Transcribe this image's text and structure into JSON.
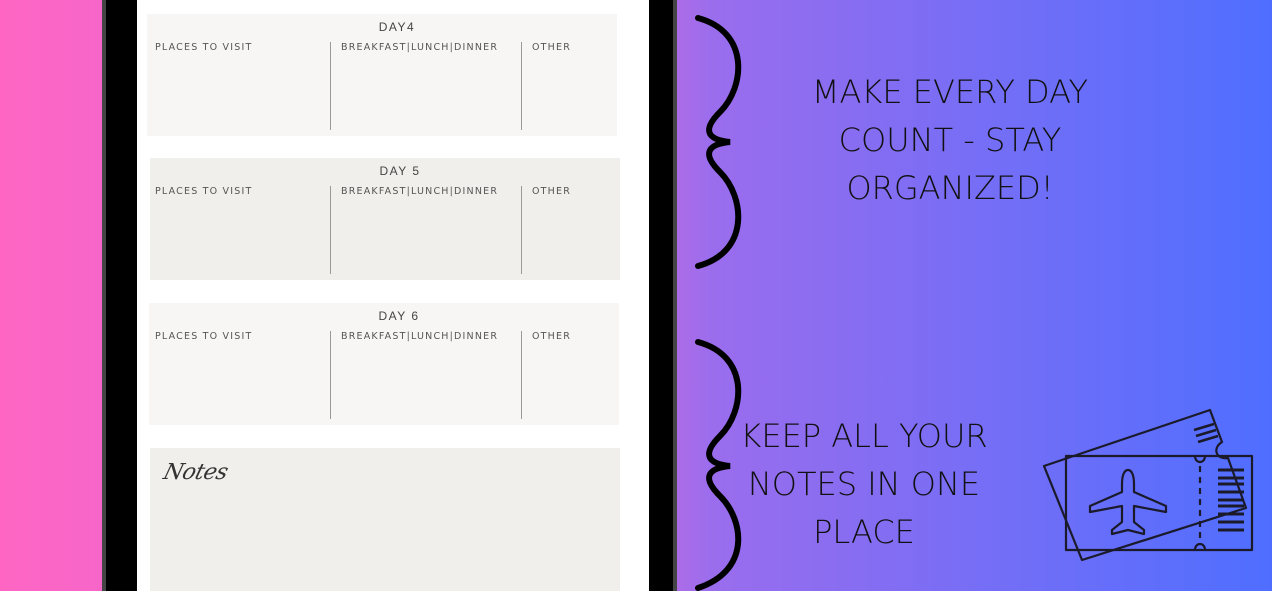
{
  "colors": {
    "left_accent": "#ff66c4",
    "gradient_start": "#c26be0",
    "gradient_end": "#4f6eff",
    "tablet_frame": "#000000",
    "card_light": "#f7f6f4",
    "card_dark": "#f0efec"
  },
  "planner": {
    "days": [
      {
        "title": "DAY4",
        "columns": [
          "PLACES TO VISIT",
          "BREAKFAST|LUNCH|DINNER",
          "OTHER"
        ]
      },
      {
        "title": "DAY 5",
        "columns": [
          "PLACES TO VISIT",
          "BREAKFAST|LUNCH|DINNER",
          "OTHER"
        ]
      },
      {
        "title": "DAY 6",
        "columns": [
          "PLACES TO VISIT",
          "BREAKFAST|LUNCH|DINNER",
          "OTHER"
        ]
      }
    ],
    "notes_title": "Notes"
  },
  "taglines": {
    "top": [
      "MAKE EVERY DAY",
      "COUNT - STAY",
      "ORGANIZED!"
    ],
    "bottom": [
      "KEEP ALL YOUR",
      "NOTES IN ONE",
      "PLACE"
    ]
  },
  "icons": {
    "ticket": "plane-ticket-icon",
    "bracket": "curly-brace-icon"
  }
}
